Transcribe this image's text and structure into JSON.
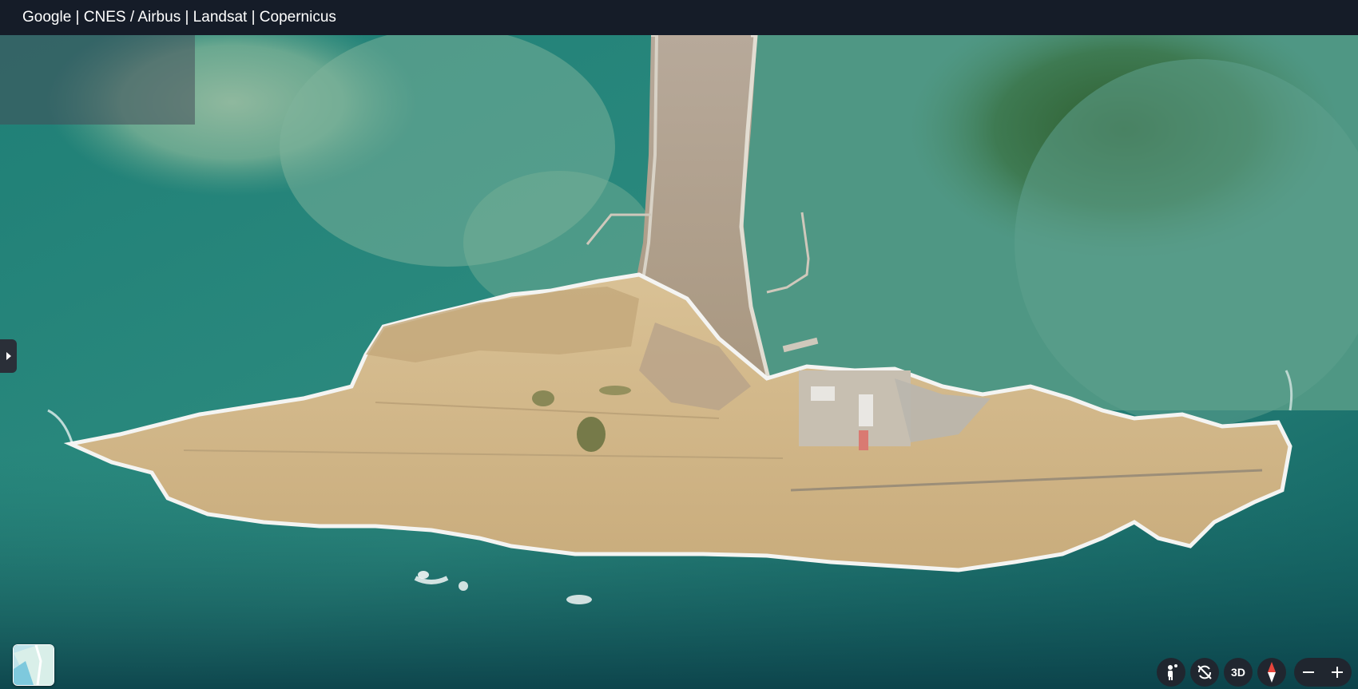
{
  "attribution": "Google | CNES / Airbus | Landsat | Copernicus",
  "map": {
    "imagery": "satellite",
    "sea_color_shallow": "#5f9c84",
    "sea_color_deep": "#0f5a5c",
    "land_color": "#d7bf90"
  },
  "controls": {
    "pegman_icon": "street-view-person-icon",
    "tilt_icon": "rotate-disabled-icon",
    "view_3d_label": "3D",
    "compass_icon": "compass-needle-icon",
    "zoom_out_icon": "minus-icon",
    "zoom_in_icon": "plus-icon"
  },
  "layer_switcher": {
    "icon": "map-layer-thumbnail"
  },
  "side_panel": {
    "toggle_icon": "chevron-right-icon"
  }
}
